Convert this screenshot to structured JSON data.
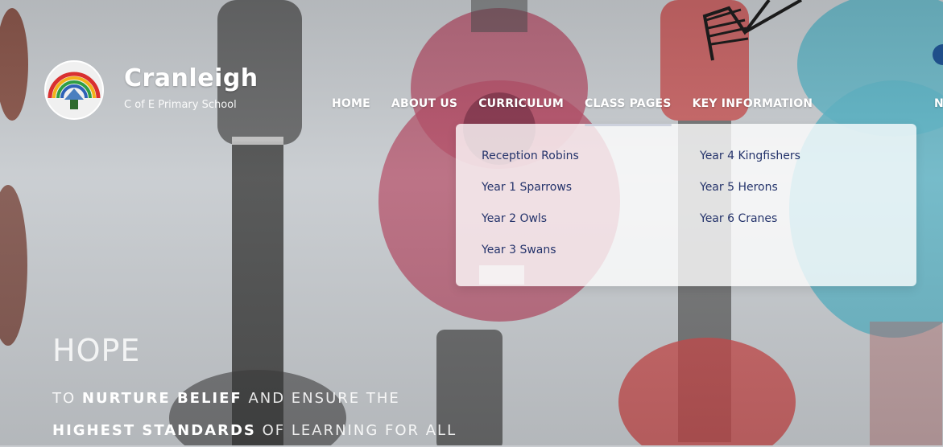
{
  "school": {
    "name": "Cranleigh",
    "subtitle": "C of E Primary School"
  },
  "nav": {
    "items": [
      {
        "label": "HOME",
        "active": false
      },
      {
        "label": "ABOUT US",
        "active": false
      },
      {
        "label": "CURRICULUM",
        "active": false
      },
      {
        "label": "CLASS PAGES",
        "active": true
      },
      {
        "label": "KEY INFORMATION",
        "active": false
      }
    ],
    "overflow_label": "N"
  },
  "dropdown": {
    "left_column": [
      "Reception Robins",
      "Year 1 Sparrows",
      "Year 2 Owls",
      "Year 3 Swans"
    ],
    "right_column": [
      "Year 4 Kingfishers",
      "Year 5 Herons",
      "Year 6 Cranes"
    ]
  },
  "hero": {
    "title": "HOPE",
    "line1_prefix": "TO ",
    "line1_bold": "NURTURE BELIEF",
    "line1_suffix": " AND ENSURE THE",
    "line2_bold": "HIGHEST STANDARDS",
    "line2_suffix": " OF LEARNING FOR ALL"
  },
  "colors": {
    "accent": "#1f2f63",
    "dropdown_link": "#24336b",
    "ukulele_pink": "#b44c66",
    "ukulele_red": "#c84c4c",
    "ukulele_teal": "#5fb4c5"
  },
  "icons": {
    "logo": "rainbow-school-crest-icon",
    "scribble": "sketch-scribble-icon"
  }
}
